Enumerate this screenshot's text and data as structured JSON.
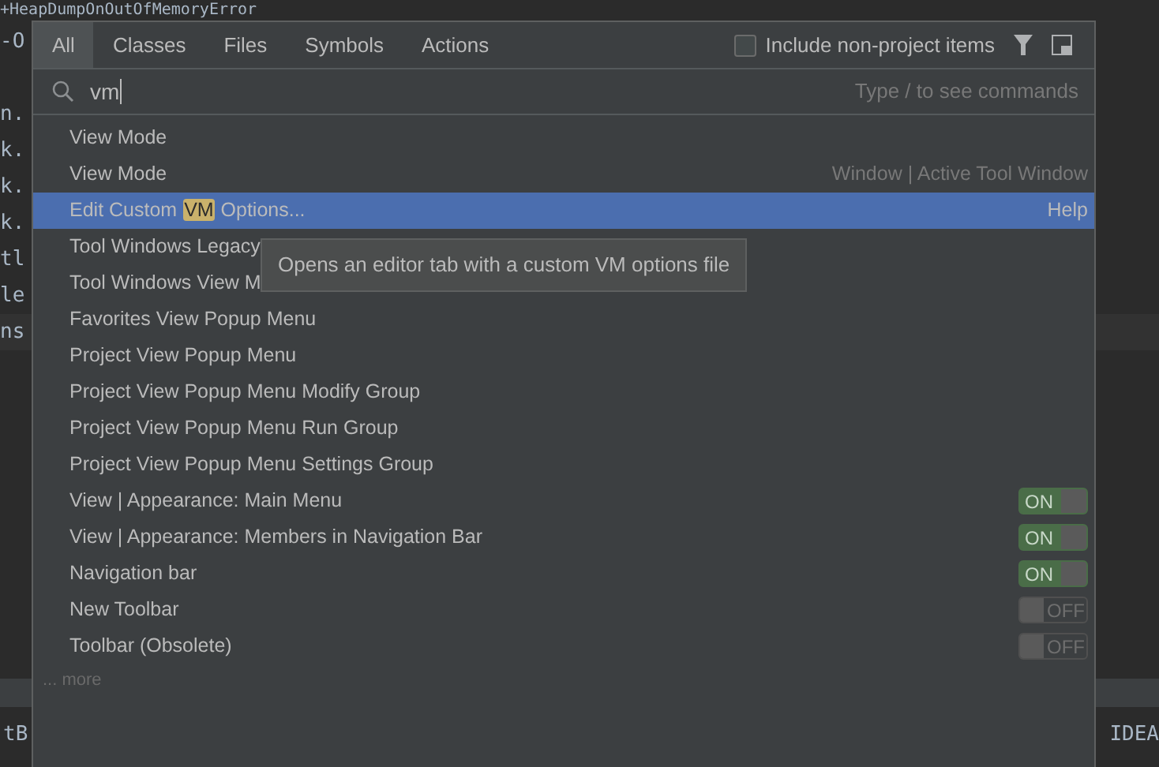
{
  "editor": {
    "lines": [
      "+HeapDumpOnOutOfMemoryError",
      "-O"
    ],
    "lines_below": [
      "n.",
      "k.",
      "k.",
      "k.",
      "tl",
      "le",
      "ns"
    ]
  },
  "bottom_panel": {
    "left_text": "tB",
    "right_text": "IDEA"
  },
  "popup": {
    "tabs": [
      {
        "label": "All",
        "selected": true
      },
      {
        "label": "Classes",
        "selected": false
      },
      {
        "label": "Files",
        "selected": false
      },
      {
        "label": "Symbols",
        "selected": false
      },
      {
        "label": "Actions",
        "selected": false
      }
    ],
    "include_checkbox": {
      "label": "Include non-project items",
      "checked": false
    },
    "search": {
      "value": "vm",
      "hint": "Type / to see commands"
    },
    "results": [
      {
        "kind": "action",
        "label": "View Mode",
        "selected": false
      },
      {
        "kind": "action",
        "label": "View Mode",
        "location": "Window | Active Tool Window",
        "selected": false
      },
      {
        "kind": "action",
        "parts": [
          {
            "text": "Edit Custom ",
            "match": false
          },
          {
            "text": "VM",
            "match": true
          },
          {
            "text": " Options...",
            "match": false
          }
        ],
        "location": "Help",
        "selected": true
      },
      {
        "kind": "action",
        "label": "Tool Windows Legacy",
        "selected": false
      },
      {
        "kind": "action",
        "label": "Tool Windows View M",
        "selected": false
      },
      {
        "kind": "action",
        "label": "Favorites View Popup Menu",
        "selected": false
      },
      {
        "kind": "action",
        "label": "Project View Popup Menu",
        "selected": false
      },
      {
        "kind": "action",
        "label": "Project View Popup Menu Modify Group",
        "selected": false
      },
      {
        "kind": "action",
        "label": "Project View Popup Menu Run Group",
        "selected": false
      },
      {
        "kind": "action",
        "label": "Project View Popup Menu Settings Group",
        "selected": false
      },
      {
        "kind": "toggle",
        "label": "View | Appearance: Main Menu",
        "on": true,
        "state_label": "ON",
        "selected": false
      },
      {
        "kind": "toggle",
        "label": "View | Appearance: Members in Navigation Bar",
        "on": true,
        "state_label": "ON",
        "selected": false
      },
      {
        "kind": "toggle",
        "label": "Navigation bar",
        "on": true,
        "state_label": "ON",
        "selected": false
      },
      {
        "kind": "toggle",
        "label": "New Toolbar",
        "on": false,
        "state_label": "OFF",
        "selected": false
      },
      {
        "kind": "toggle",
        "label": "Toolbar (Obsolete)",
        "on": false,
        "state_label": "OFF",
        "selected": false
      }
    ],
    "more_link": "... more",
    "tooltip": "Opens an editor tab with a custom VM options file"
  }
}
